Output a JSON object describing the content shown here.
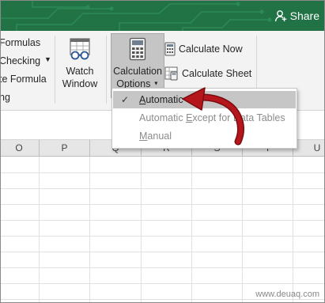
{
  "titlebar": {
    "share_label": "Share",
    "bg": "#217346"
  },
  "ribbon": {
    "left_items": [
      "Formulas",
      "Checking",
      "te Formula",
      "ng"
    ],
    "watch": {
      "line1": "Watch",
      "line2": "Window"
    },
    "calc_options": {
      "line1": "Calculation",
      "line2": "Options"
    },
    "calc_now": "Calculate Now",
    "calc_sheet": "Calculate Sheet"
  },
  "columns": [
    "O",
    "P",
    "Q",
    "R",
    "S",
    "T",
    "U"
  ],
  "menu": {
    "items": [
      {
        "pre": "",
        "ul": "A",
        "post": "utomatic",
        "checked": true,
        "selected": true,
        "enabled": true
      },
      {
        "pre": "Automatic ",
        "ul": "E",
        "post": "xcept for Data Tables",
        "checked": false,
        "selected": false,
        "enabled": false
      },
      {
        "pre": "",
        "ul": "M",
        "post": "anual",
        "checked": false,
        "selected": false,
        "enabled": false
      }
    ],
    "check_glyph": "✓"
  },
  "accent_arrow": "#b4161b",
  "watermark": "www.deuaq.com"
}
